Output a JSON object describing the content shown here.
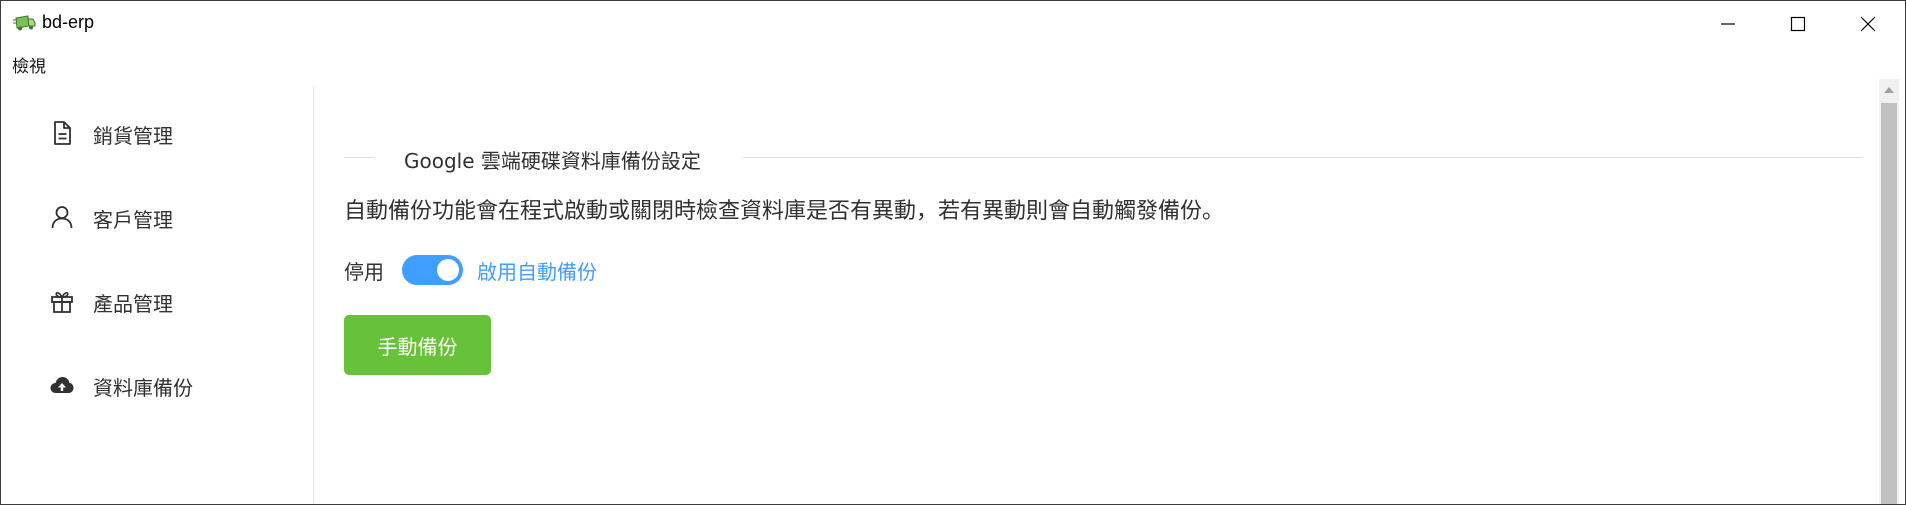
{
  "window": {
    "title": "bd-erp",
    "app_icon": "truck-icon",
    "controls": [
      "minimize-icon",
      "maximize-icon",
      "close-icon"
    ]
  },
  "menubar": {
    "items": [
      {
        "label": "檢視"
      }
    ]
  },
  "sidebar": {
    "items": [
      {
        "label": "銷貨管理",
        "icon": "document-icon"
      },
      {
        "label": "客戶管理",
        "icon": "user-icon"
      },
      {
        "label": "產品管理",
        "icon": "gift-icon"
      },
      {
        "label": "資料庫備份",
        "icon": "cloud-upload-icon"
      }
    ]
  },
  "main": {
    "section_title": "Google 雲端硬碟資料庫備份設定",
    "description": "自動備份功能會在程式啟動或關閉時檢查資料庫是否有異動，若有異動則會自動觸發備份。",
    "auto_backup_switch": {
      "inactive_text": "停用",
      "active_text": "啟用自動備份",
      "enabled": true
    },
    "manual_backup_label": "手動備份"
  },
  "colors": {
    "primary": "#409eff",
    "success": "#67c23a",
    "text": "#303133",
    "border": "#dcdfe6"
  }
}
